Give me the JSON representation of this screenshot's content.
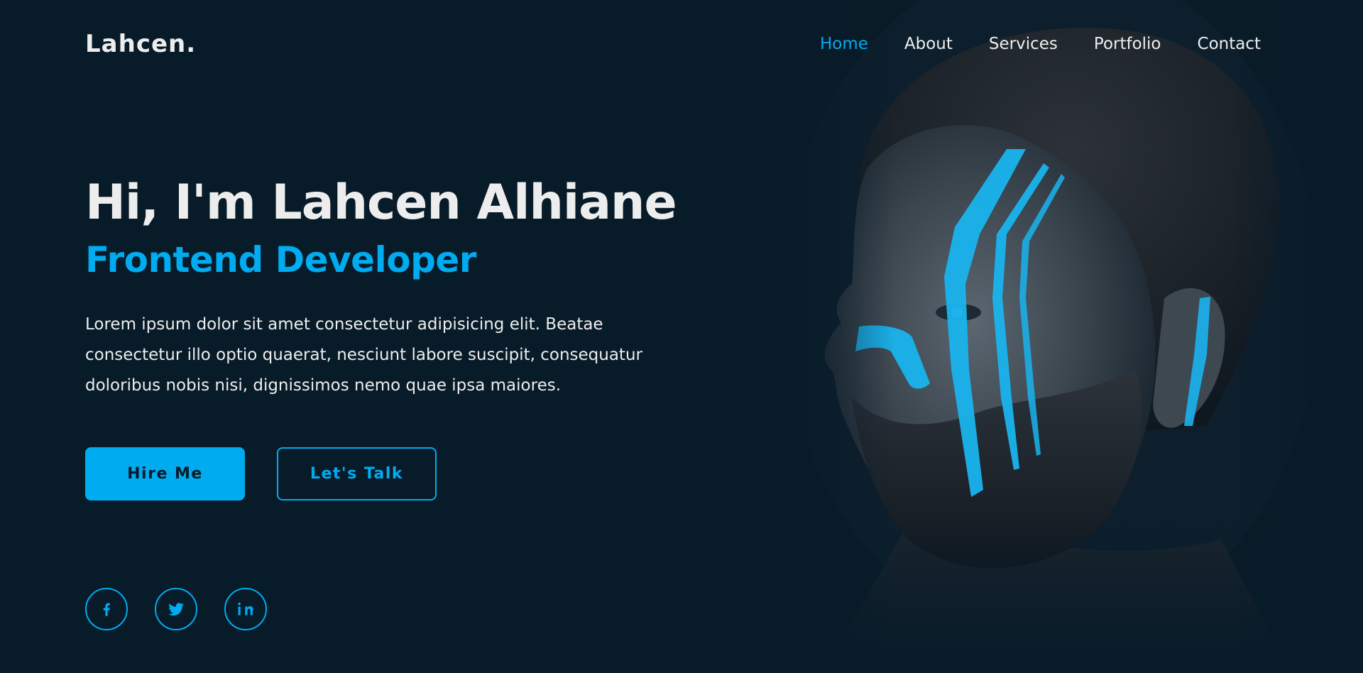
{
  "header": {
    "logo": "Lahcen.",
    "nav": [
      {
        "label": "Home",
        "active": true
      },
      {
        "label": "About",
        "active": false
      },
      {
        "label": "Services",
        "active": false
      },
      {
        "label": "Portfolio",
        "active": false
      },
      {
        "label": "Contact",
        "active": false
      }
    ]
  },
  "home": {
    "title": "Hi, I'm Lahcen Alhiane",
    "subtitle": "Frontend Developer",
    "description": "Lorem ipsum dolor sit amet consectetur adipisicing elit. Beatae consectetur illo optio quaerat, nesciunt labore suscipit, consequatur doloribus nobis nisi, dignissimos nemo quae ipsa maiores.",
    "buttons": {
      "primary": "Hire Me",
      "secondary": "Let's Talk"
    }
  },
  "social": [
    {
      "icon": "facebook-icon"
    },
    {
      "icon": "twitter-icon"
    },
    {
      "icon": "linkedin-icon"
    }
  ],
  "colors": {
    "background": "#081b29",
    "accent": "#00abf0",
    "text": "#ededed"
  }
}
